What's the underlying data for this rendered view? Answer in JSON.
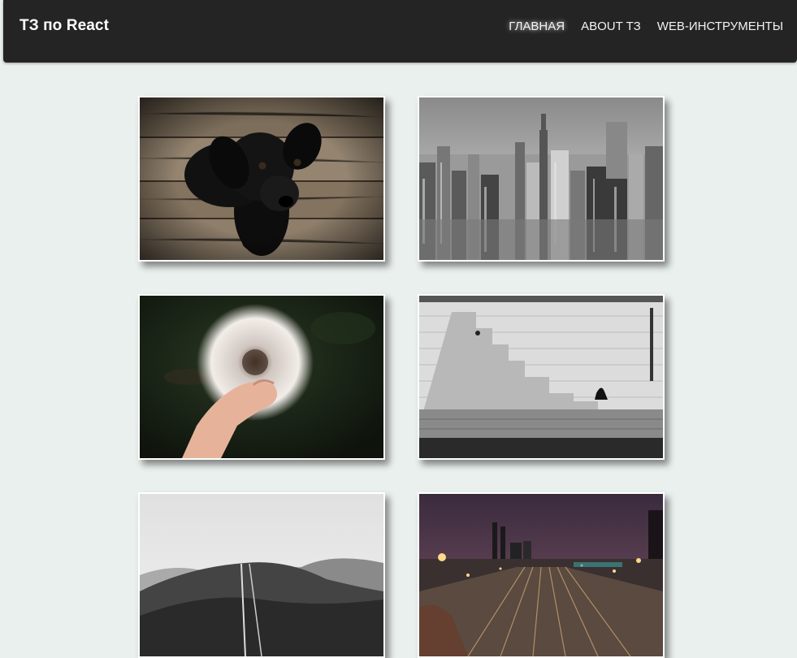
{
  "header": {
    "brand": "ТЗ по React",
    "nav": [
      {
        "label": "ГЛАВНАЯ",
        "active": true
      },
      {
        "label": "ABOUT ТЗ",
        "active": false
      },
      {
        "label": "WEB-ИНСТРУМЕНТЫ",
        "active": false
      }
    ]
  },
  "gallery": {
    "photos": [
      {
        "subject": "black-puppy-on-wooden-floor"
      },
      {
        "subject": "city-skyline-black-and-white"
      },
      {
        "subject": "hand-holding-dandelion"
      },
      {
        "subject": "stone-stairs-wall-with-sitting-person"
      },
      {
        "subject": "misty-hills-black-and-white"
      },
      {
        "subject": "railway-yard-at-night"
      }
    ]
  },
  "colors": {
    "navbar_bg": "#242424",
    "page_bg": "#eaf0ee",
    "nav_text": "#f2f2f2"
  }
}
